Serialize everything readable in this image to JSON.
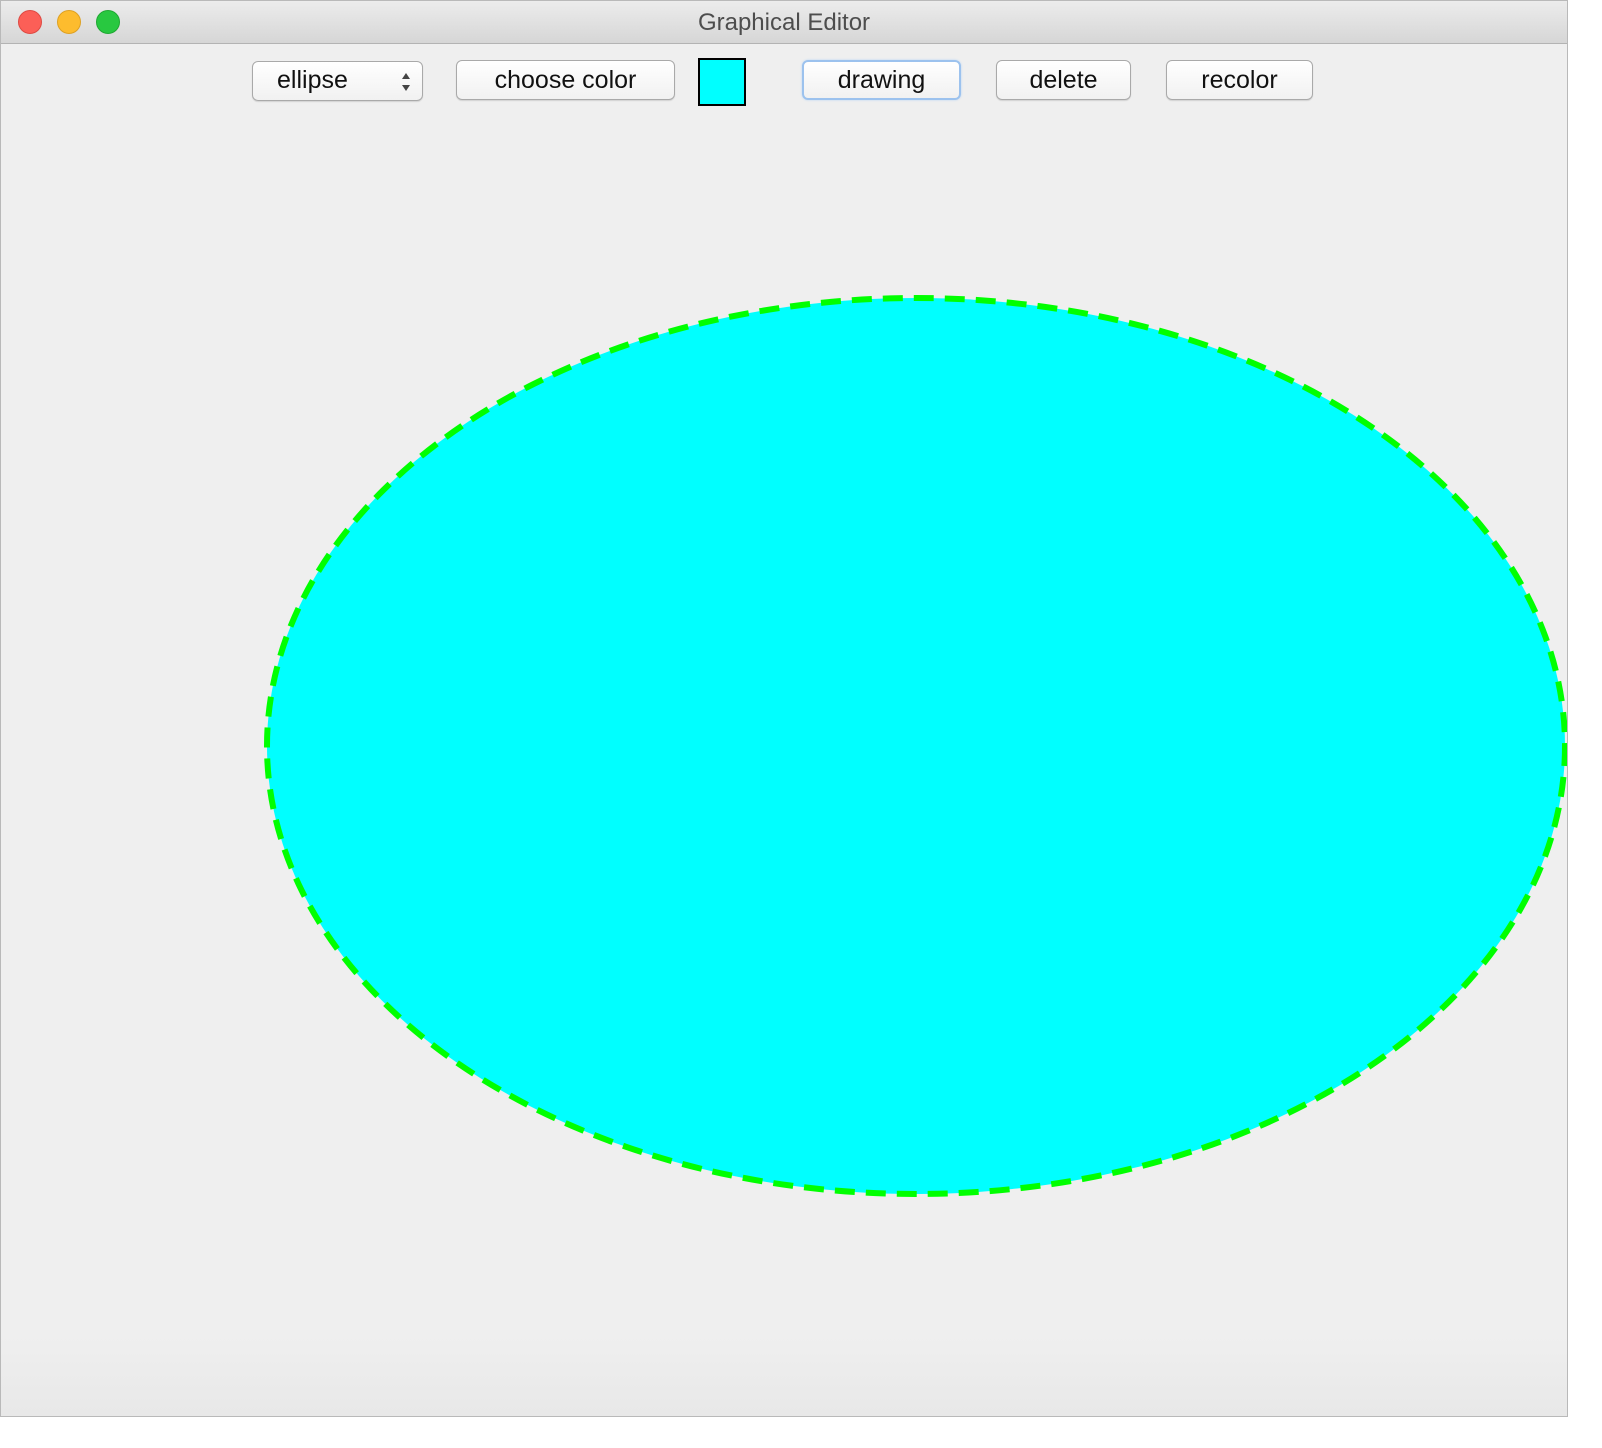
{
  "window": {
    "title": "Graphical Editor"
  },
  "toolbar": {
    "shape_select": {
      "value": "ellipse",
      "options": [
        "ellipse"
      ]
    },
    "choose_color_label": "choose color",
    "current_color": "#00ffff",
    "drawing_label": "drawing",
    "delete_label": "delete",
    "recolor_label": "recolor"
  },
  "canvas": {
    "shapes": [
      {
        "type": "ellipse",
        "fill": "#00ffff",
        "selected": true,
        "selection_outline_color": "#00ff00"
      }
    ]
  },
  "colors": {
    "traffic_close": "#fc5f57",
    "traffic_minimize": "#fdbc2e",
    "traffic_zoom": "#28c840",
    "window_background": "#efefef",
    "focus_ring": "#9cc2ee"
  }
}
